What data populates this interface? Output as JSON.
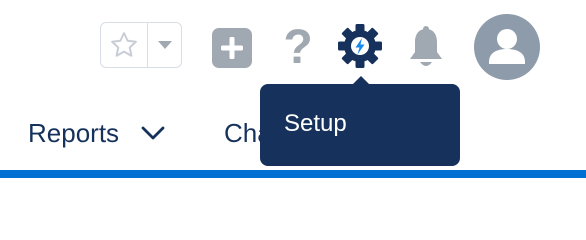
{
  "colors": {
    "brand_blue": "#0070d2",
    "navy": "#16325c",
    "icon_gray": "#a0a8b1",
    "avatar_gray": "#8e9bab",
    "lightning": "#1589ee"
  },
  "header": {
    "icons": {
      "favorites": "star-icon",
      "favorites_menu": "chevron-down-icon",
      "global_actions": "plus-icon",
      "help": "question-mark-icon",
      "setup": "gear-icon",
      "notifications": "bell-icon",
      "profile": "avatar-icon"
    },
    "help_glyph": "?"
  },
  "tooltip": {
    "text": "Setup"
  },
  "nav": {
    "items": [
      {
        "label": "Reports",
        "icon": "chevron-down-icon"
      },
      {
        "label": "Cha"
      }
    ]
  }
}
